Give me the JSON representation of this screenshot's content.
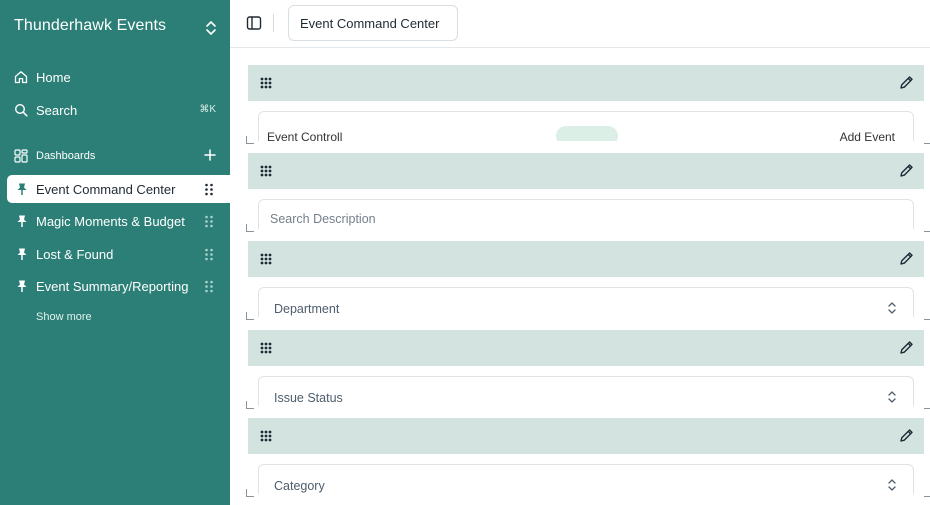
{
  "workspace": {
    "name": "Thunderhawk Events"
  },
  "nav": {
    "home": "Home",
    "search": "Search",
    "search_shortcut": "⌘K",
    "dashboards": "Dashboards"
  },
  "pinned": [
    {
      "label": "Event Command Center",
      "active": true
    },
    {
      "label": "Magic Moments & Budget",
      "active": false
    },
    {
      "label": "Lost & Found",
      "active": false
    },
    {
      "label": "Event Summary/Reporting",
      "active": false
    }
  ],
  "show_more": "Show more",
  "topbar": {
    "title": "Event Command Center"
  },
  "blocks": [
    {
      "type": "table-peek",
      "text_left": "Event Controll",
      "text_right": "Add Event"
    },
    {
      "type": "search",
      "placeholder": "Search Description"
    },
    {
      "type": "select",
      "label": "Department"
    },
    {
      "type": "select",
      "label": "Issue Status"
    },
    {
      "type": "select",
      "label": "Category"
    }
  ],
  "colors": {
    "sidebar": "#2b7f76",
    "block_header": "#d2e3e0",
    "active_item_bg": "#ffffff",
    "badge": "#dcefe6"
  },
  "icons": {
    "workspace_switch": "chevron-updown-icon",
    "home": "home-icon",
    "search": "search-icon",
    "dashboards": "dashboard-grid-icon",
    "add": "plus-icon",
    "pin": "pin-icon",
    "grip": "grip-dots-icon",
    "sidebar_toggle": "sidebar-toggle-icon",
    "drag": "drag-handle-icon",
    "edit": "pencil-icon",
    "select": "chevron-updown-icon"
  }
}
